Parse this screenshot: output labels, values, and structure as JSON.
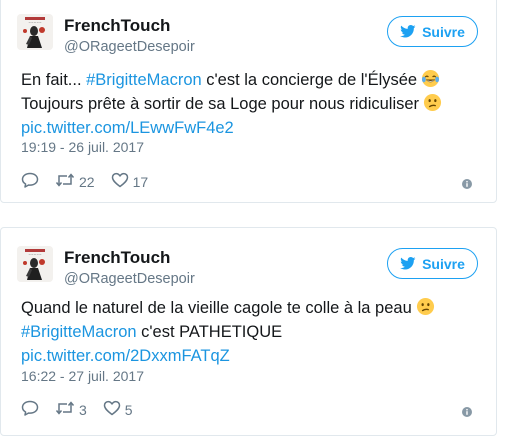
{
  "colors": {
    "link": "#1b95e0",
    "brand": "#1da1f2",
    "muted": "#657786",
    "text": "#14171a",
    "border": "#e1e8ed"
  },
  "tweets": [
    {
      "author": {
        "name": "FrenchTouch",
        "handle": "@ORageetDesepoir"
      },
      "follow_label": "Suivre",
      "text": {
        "line1_prefix": "En fait... ",
        "line1_hashtag": "#BrigitteMacron",
        "line1_rest": " c'est la concierge de l'Élysée",
        "line1_emoji": "face-with-tears-of-joy",
        "line2": "Toujours prête à sortir de sa Loge pour nous ridiculiser",
        "line2_emoji": "confused-face",
        "link": "pic.twitter.com/LEwwFwF4e2"
      },
      "timestamp": "19:19 - 26 juil. 2017",
      "retweets": "22",
      "likes": "17"
    },
    {
      "author": {
        "name": "FrenchTouch",
        "handle": "@ORageetDesepoir"
      },
      "follow_label": "Suivre",
      "text": {
        "line1": "Quand le naturel de la vieille cagole te colle à la peau",
        "line1_emoji": "confused-face",
        "line2_hashtag": "#BrigitteMacron",
        "line2_rest": " c'est PATHETIQUE",
        "link": "pic.twitter.com/2DxxmFATqZ"
      },
      "timestamp": "16:22 - 27 juil. 2017",
      "retweets": "3",
      "likes": "5"
    }
  ]
}
